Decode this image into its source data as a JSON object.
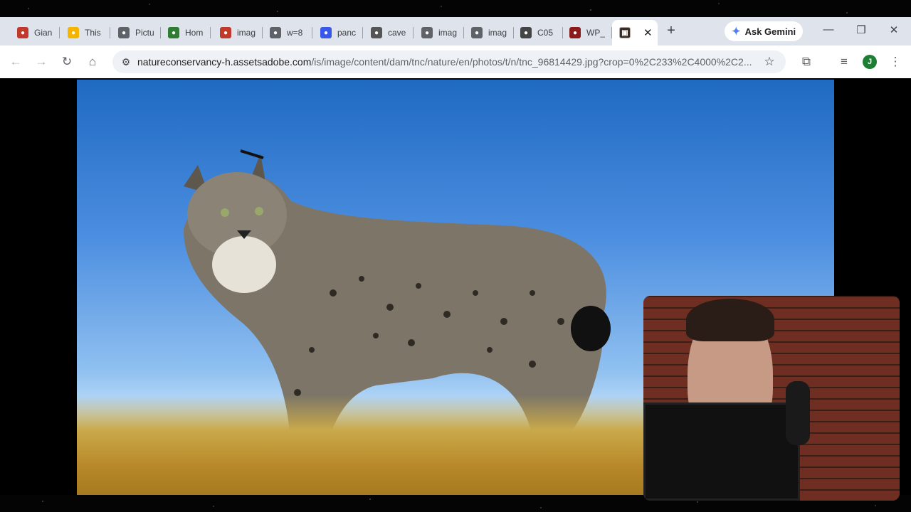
{
  "tabs": [
    {
      "title": "Gian",
      "icon": "site-red-icon",
      "color": "#c0392b"
    },
    {
      "title": "This",
      "icon": "s-badge-icon",
      "color": "#f4b400"
    },
    {
      "title": "Pictu",
      "icon": "globe-icon",
      "color": "#5f6368"
    },
    {
      "title": "Hom",
      "icon": "wikimedia-icon",
      "color": "#2e7d32"
    },
    {
      "title": "imag",
      "icon": "site-red-icon",
      "color": "#c0392b"
    },
    {
      "title": "w=8",
      "icon": "globe-icon",
      "color": "#5f6368"
    },
    {
      "title": "panc",
      "icon": "wordpress-icon",
      "color": "#3858e9"
    },
    {
      "title": "cave",
      "icon": "cave-icon",
      "color": "#555555"
    },
    {
      "title": "imag",
      "icon": "globe-icon",
      "color": "#5f6368"
    },
    {
      "title": "imag",
      "icon": "globe-icon",
      "color": "#5f6368"
    },
    {
      "title": "C05",
      "icon": "c-box-icon",
      "color": "#444444"
    },
    {
      "title": "WP_",
      "icon": "art-icon",
      "color": "#8b1a1a"
    }
  ],
  "active_tab": {
    "icon": "image-favicon",
    "color": "#3a2a20"
  },
  "gemini_label": "Ask Gemini",
  "url": {
    "host": "natureconservancy-h.assetsadobe.com",
    "path": "/is/image/content/dam/tnc/nature/en/photos/t/n/tnc_96814429.jpg?crop=0%2C233%2C4000%2C2..."
  },
  "profile_initial": "J"
}
